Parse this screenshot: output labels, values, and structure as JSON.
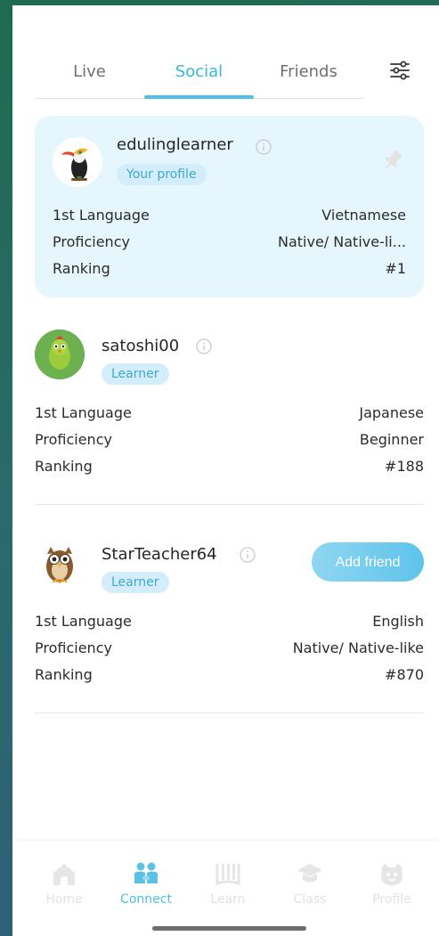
{
  "tabs": [
    {
      "label": "Live"
    },
    {
      "label": "Social"
    },
    {
      "label": "Friends"
    }
  ],
  "active_tab": "Social",
  "icons": {
    "filter": "sliders-icon",
    "info": "info-icon",
    "pin": "pin-icon"
  },
  "colors": {
    "accent": "#4fc0e6",
    "card_bg": "#e6f6fd",
    "badge_bg": "#d3eefa",
    "badge_text": "#41a8d2"
  },
  "profiles": [
    {
      "username": "edulinglearner",
      "badge": "Your profile",
      "rows": [
        {
          "label": "1st Language",
          "value": "Vietnamese"
        },
        {
          "label": "Proficiency",
          "value": "Native/ Native-li..."
        },
        {
          "label": "Ranking",
          "value": "#1"
        }
      ]
    },
    {
      "username": "satoshi00",
      "badge": "Learner",
      "rows": [
        {
          "label": "1st Language",
          "value": "Japanese"
        },
        {
          "label": "Proficiency",
          "value": "Beginner"
        },
        {
          "label": "Ranking",
          "value": "#188"
        }
      ]
    },
    {
      "username": "StarTeacher64",
      "badge": "Learner",
      "action": "Add friend",
      "rows": [
        {
          "label": "1st Language",
          "value": "English"
        },
        {
          "label": "Proficiency",
          "value": "Native/ Native-like"
        },
        {
          "label": "Ranking",
          "value": "#870"
        }
      ]
    }
  ],
  "bottom_nav": [
    {
      "label": "Home",
      "icon": "home-icon"
    },
    {
      "label": "Connect",
      "icon": "people-icon"
    },
    {
      "label": "Learn",
      "icon": "book-icon"
    },
    {
      "label": "Class",
      "icon": "graduation-cap-icon"
    },
    {
      "label": "Profile",
      "icon": "face-icon"
    }
  ],
  "active_nav": "Connect"
}
